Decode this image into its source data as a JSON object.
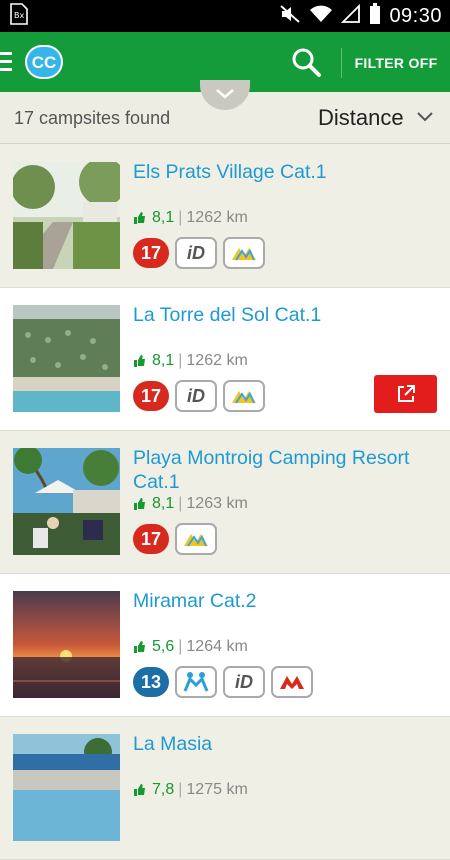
{
  "status_bar": {
    "time": "09:30"
  },
  "app_bar": {
    "logo": "CC",
    "filter_label": "FILTER OFF"
  },
  "results": {
    "count_text": "17 campsites found",
    "sort_value": "Distance"
  },
  "items": [
    {
      "name": "Els Prats Village Cat.1",
      "rating": "8,1",
      "distance": "1262 km",
      "cat_badge": "17"
    },
    {
      "name": "La Torre del Sol Cat.1",
      "rating": "8,1",
      "distance": "1262 km",
      "cat_badge": "17"
    },
    {
      "name": "Playa Montroig Camping Resort Cat.1",
      "rating": "8,1",
      "distance": "1263 km",
      "cat_badge": "17"
    },
    {
      "name": "Miramar Cat.2",
      "rating": "5,6",
      "distance": "1264 km",
      "cat_badge": "13"
    },
    {
      "name": "La Masia",
      "rating": "7,8",
      "distance": "1275 km",
      "cat_badge": ""
    }
  ],
  "colors": {
    "brand_green": "#149c3a",
    "link_blue": "#1e9ad3",
    "rating_green": "#16992e",
    "badge_red": "#d8291f",
    "badge_blue": "#1b6fa6",
    "action_red": "#e31c1c"
  },
  "badge_labels": {
    "id": "iD"
  }
}
